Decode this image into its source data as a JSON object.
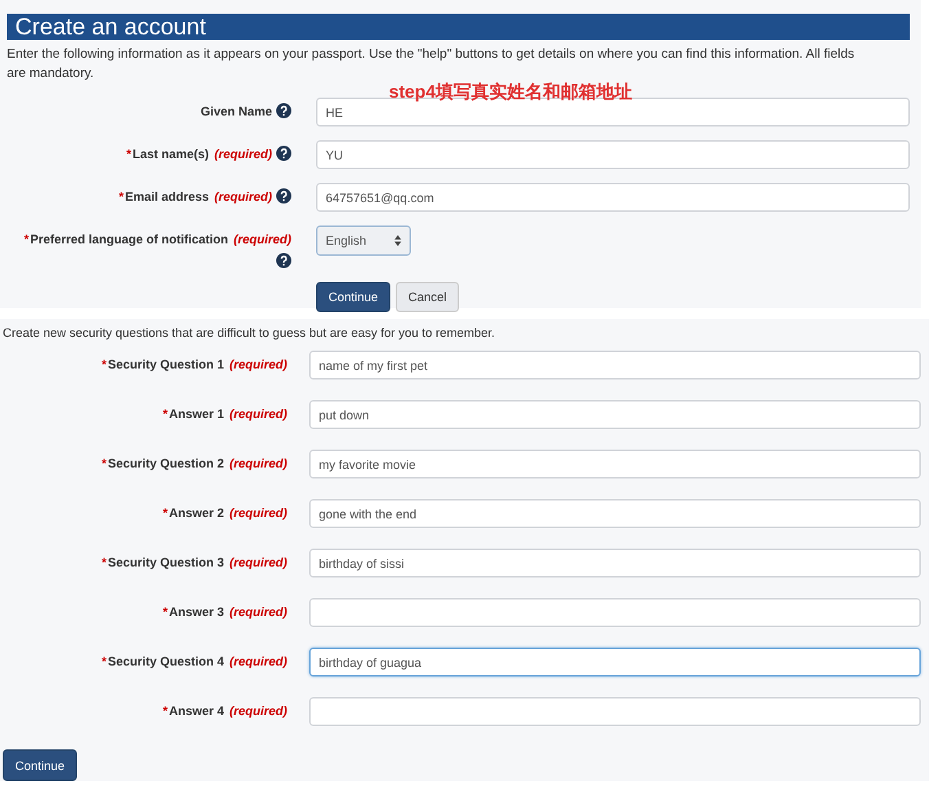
{
  "account": {
    "title": "Create an account",
    "intro": "Enter the following information as it appears on your passport. Use the \"help\" buttons to get details on where you can find this information. All fields are mandatory.",
    "annotation": "step4填写真实姓名和邮箱地址",
    "fields": [
      {
        "kind": "text",
        "label": "Given Name",
        "help": true,
        "value": "HE"
      },
      {
        "kind": "text",
        "star": "*",
        "label": "Last name(s)",
        "required_text": "(required)",
        "help": true,
        "value": "YU"
      },
      {
        "kind": "text",
        "star": "*",
        "label": "Email address",
        "required_text": "(required)",
        "help": true,
        "value": "64757651@qq.com"
      },
      {
        "kind": "select",
        "star": "*",
        "label": "Preferred language of notification",
        "required_text": "(required)",
        "help": true,
        "value": "English"
      }
    ],
    "buttons": [
      {
        "label": "Continue",
        "primary": true
      },
      {
        "label": "Cancel",
        "primary": false
      }
    ]
  },
  "security": {
    "intro": "Create new security questions that are difficult to guess but are easy for you to remember.",
    "fields": [
      {
        "star": "*",
        "label": "Security Question 1",
        "required_text": "(required)",
        "value": "name of my first pet",
        "focused": false
      },
      {
        "star": "*",
        "label": "Answer 1",
        "required_text": "(required)",
        "value": "put down",
        "focused": false
      },
      {
        "star": "*",
        "label": "Security Question 2",
        "required_text": "(required)",
        "value": "my favorite movie",
        "focused": false
      },
      {
        "star": "*",
        "label": "Answer 2",
        "required_text": "(required)",
        "value": "gone with the end",
        "focused": false
      },
      {
        "star": "*",
        "label": "Security Question 3",
        "required_text": "(required)",
        "value": "birthday of sissi",
        "focused": false
      },
      {
        "star": "*",
        "label": "Answer 3",
        "required_text": "(required)",
        "focused": false
      },
      {
        "star": "*",
        "label": "Security Question 4",
        "required_text": "(required)",
        "value": "birthday of guagua",
        "focused": true
      },
      {
        "star": "*",
        "label": "Answer 4",
        "required_text": "(required)",
        "focused": false
      }
    ],
    "button": "Continue"
  }
}
